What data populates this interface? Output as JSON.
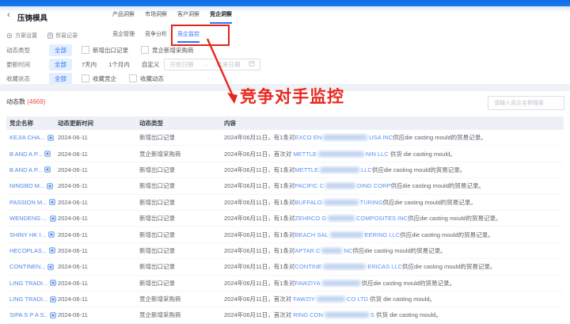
{
  "header": {
    "back_icon": "‹",
    "title": "压铸模具",
    "actions": [
      {
        "label": "方案设置",
        "icon": "gear-circle"
      },
      {
        "label": "贸易记录",
        "icon": "document"
      }
    ],
    "tabs": [
      {
        "label": "产品洞察"
      },
      {
        "label": "市场洞察"
      },
      {
        "label": "客户洞察"
      },
      {
        "label": "竞企洞察",
        "active": true
      }
    ],
    "subtabs": [
      {
        "label": "竞企管理"
      },
      {
        "label": "竞争分析"
      },
      {
        "label": "竞企监控",
        "active": true
      }
    ]
  },
  "filters": {
    "rows": [
      {
        "label": "动态类型",
        "all": "全部",
        "checks": [
          "新增出口记录",
          "竞企新增采购商"
        ]
      },
      {
        "label": "更新时间",
        "all": "全部",
        "quick": [
          "7天内",
          "1个月内",
          "自定义"
        ],
        "date_start": "开始日期",
        "date_arrow": "→",
        "date_end": "结束日期"
      },
      {
        "label": "收藏状态",
        "all": "全部",
        "checks": [
          "收藏竞企",
          "收藏动态"
        ]
      }
    ]
  },
  "annotation": {
    "text": "竞争对手监控"
  },
  "stats": {
    "label": "动态数",
    "count": "(4669)"
  },
  "search": {
    "placeholder": "请输入竞企名称搜索"
  },
  "table": {
    "columns": [
      "竞企名称",
      "动态更新时间",
      "动态类型",
      "内容"
    ],
    "rows": [
      {
        "name": "KEJIA CHA...",
        "date": "2024-06-11",
        "type": "新增出口记录",
        "content": [
          {
            "t": "2024年06月11日，有1条对"
          },
          {
            "t": "EXCO EN",
            "l": 1
          },
          {
            "b": 56
          },
          {
            "t": "USA INC",
            "l": 1
          },
          {
            "t": "供应die casting mould的贸易记录。"
          }
        ]
      },
      {
        "name": "B AND A P...",
        "date": "2024-06-11",
        "type": "竞企新增采购商",
        "content": [
          {
            "t": "2024年06月11日，首次对 "
          },
          {
            "t": "METTLE",
            "l": 1
          },
          {
            "b": 58
          },
          {
            "t": "NIN LLC",
            "l": 1
          },
          {
            "t": " 供货 die casting mould。"
          }
        ]
      },
      {
        "name": "B AND A P...",
        "date": "2024-06-11",
        "type": "新增出口记录",
        "content": [
          {
            "t": "2024年06月11日，有1条对"
          },
          {
            "t": "METTLE",
            "l": 1
          },
          {
            "b": 50
          },
          {
            "t": "LLC",
            "l": 1
          },
          {
            "t": "供应die casting mould的贸易记录。"
          }
        ]
      },
      {
        "name": "NINGBO M...",
        "date": "2024-06-11",
        "type": "新增出口记录",
        "content": [
          {
            "t": "2024年06月11日，有1条对"
          },
          {
            "t": "PACIFIC C",
            "l": 1
          },
          {
            "b": 38
          },
          {
            "t": "DING CORP",
            "l": 1
          },
          {
            "t": "供应die casting mould的贸易记录。"
          }
        ]
      },
      {
        "name": "PASSION M...",
        "date": "2024-06-11",
        "type": "新增出口记录",
        "content": [
          {
            "t": "2024年06月11日，有1条对"
          },
          {
            "t": "BUFFALO",
            "l": 1
          },
          {
            "b": 44
          },
          {
            "t": "TURING",
            "l": 1
          },
          {
            "t": "供应die casting mould的贸易记录。"
          }
        ]
      },
      {
        "name": "WENDENG ...",
        "date": "2024-06-11",
        "type": "新增出口记录",
        "content": [
          {
            "t": "2024年06月11日，有1条对"
          },
          {
            "t": "ZEHRCO G",
            "l": 1
          },
          {
            "b": 34
          },
          {
            "t": "COMPOSITES INC",
            "l": 1
          },
          {
            "t": "供应die casting mould的贸易记录。"
          }
        ]
      },
      {
        "name": "SHINY HK I...",
        "date": "2024-06-11",
        "type": "新增出口记录",
        "content": [
          {
            "t": "2024年06月11日，有1条对"
          },
          {
            "t": "BEACH SAL",
            "l": 1
          },
          {
            "b": 42
          },
          {
            "t": "EERING LLC",
            "l": 1
          },
          {
            "t": "供应die casting mould的贸易记录。"
          }
        ]
      },
      {
        "name": "HECOPLAS...",
        "date": "2024-06-11",
        "type": "新增出口记录",
        "content": [
          {
            "t": "2024年06月11日，有1条对"
          },
          {
            "t": "APTAR C",
            "l": 1
          },
          {
            "b": 26
          },
          {
            "t": "NC",
            "l": 1
          },
          {
            "t": "供应die casting mould的贸易记录。"
          }
        ]
      },
      {
        "name": "CONTINEN...",
        "date": "2024-06-11",
        "type": "新增出口记录",
        "content": [
          {
            "t": "2024年06月11日，有1条对"
          },
          {
            "t": "CONTINE",
            "l": 1
          },
          {
            "b": 54
          },
          {
            "t": "ERICAS LLC",
            "l": 1
          },
          {
            "t": "供应die casting mould的贸易记录。"
          }
        ]
      },
      {
        "name": "LING TRADI...",
        "date": "2024-06-11",
        "type": "新增出口记录",
        "content": [
          {
            "t": "2024年06月11日，有1条对"
          },
          {
            "t": "FAWZIYA",
            "l": 1
          },
          {
            "b": 48
          },
          {
            "t": "供应die casting mould的贸易记录。"
          }
        ]
      },
      {
        "name": "LING TRADI...",
        "date": "2024-06-11",
        "type": "竞企新增采购商",
        "content": [
          {
            "t": "2024年06月11日，首次对 "
          },
          {
            "t": "FAWZIY",
            "l": 1
          },
          {
            "b": 36
          },
          {
            "t": "CO LTD",
            "l": 1
          },
          {
            "t": " 供货 die casting mould。"
          }
        ]
      },
      {
        "name": "SIPA S P A S...",
        "date": "2024-06-11",
        "type": "竞企新增采购商",
        "content": [
          {
            "t": "2024年06月11日，首次对 "
          },
          {
            "t": "RING CON",
            "l": 1
          },
          {
            "b": 56
          },
          {
            "t": "S",
            "l": 1
          },
          {
            "t": " 供货 die casting mould。"
          }
        ]
      }
    ]
  },
  "colors": {
    "accent": "#3370ff",
    "annotation_red": "#e8281e",
    "count_red": "#f5483b",
    "link_blue": "#5b8ff9",
    "topbar_blue": "#1273ec"
  },
  "icons": {
    "back": "chevron-left",
    "settings": "gear-circle",
    "trade_records": "document",
    "company_detail": "building-square",
    "calendar": "calendar",
    "date_range_arrow": "→"
  }
}
